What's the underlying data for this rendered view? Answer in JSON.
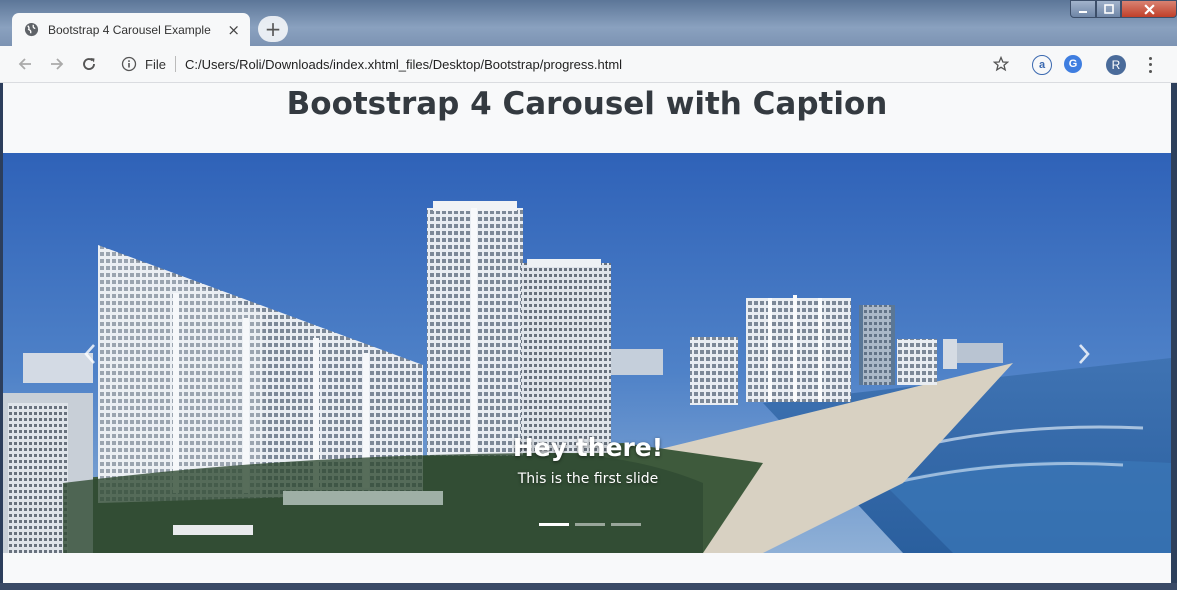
{
  "browser": {
    "tab_title": "Bootstrap 4 Carousel Example",
    "tab_close": "×",
    "new_tab": "+",
    "scheme_label": "File",
    "url": "C:/Users/Roli/Downloads/index.xhtml_files/Desktop/Bootstrap/progress.html",
    "profile_initial": "R"
  },
  "page": {
    "title": "Bootstrap 4 Carousel with Caption"
  },
  "carousel": {
    "caption_title": "Hey there!",
    "caption_text": "This is the first slide",
    "slides_count": 3,
    "active_slide": 1
  }
}
